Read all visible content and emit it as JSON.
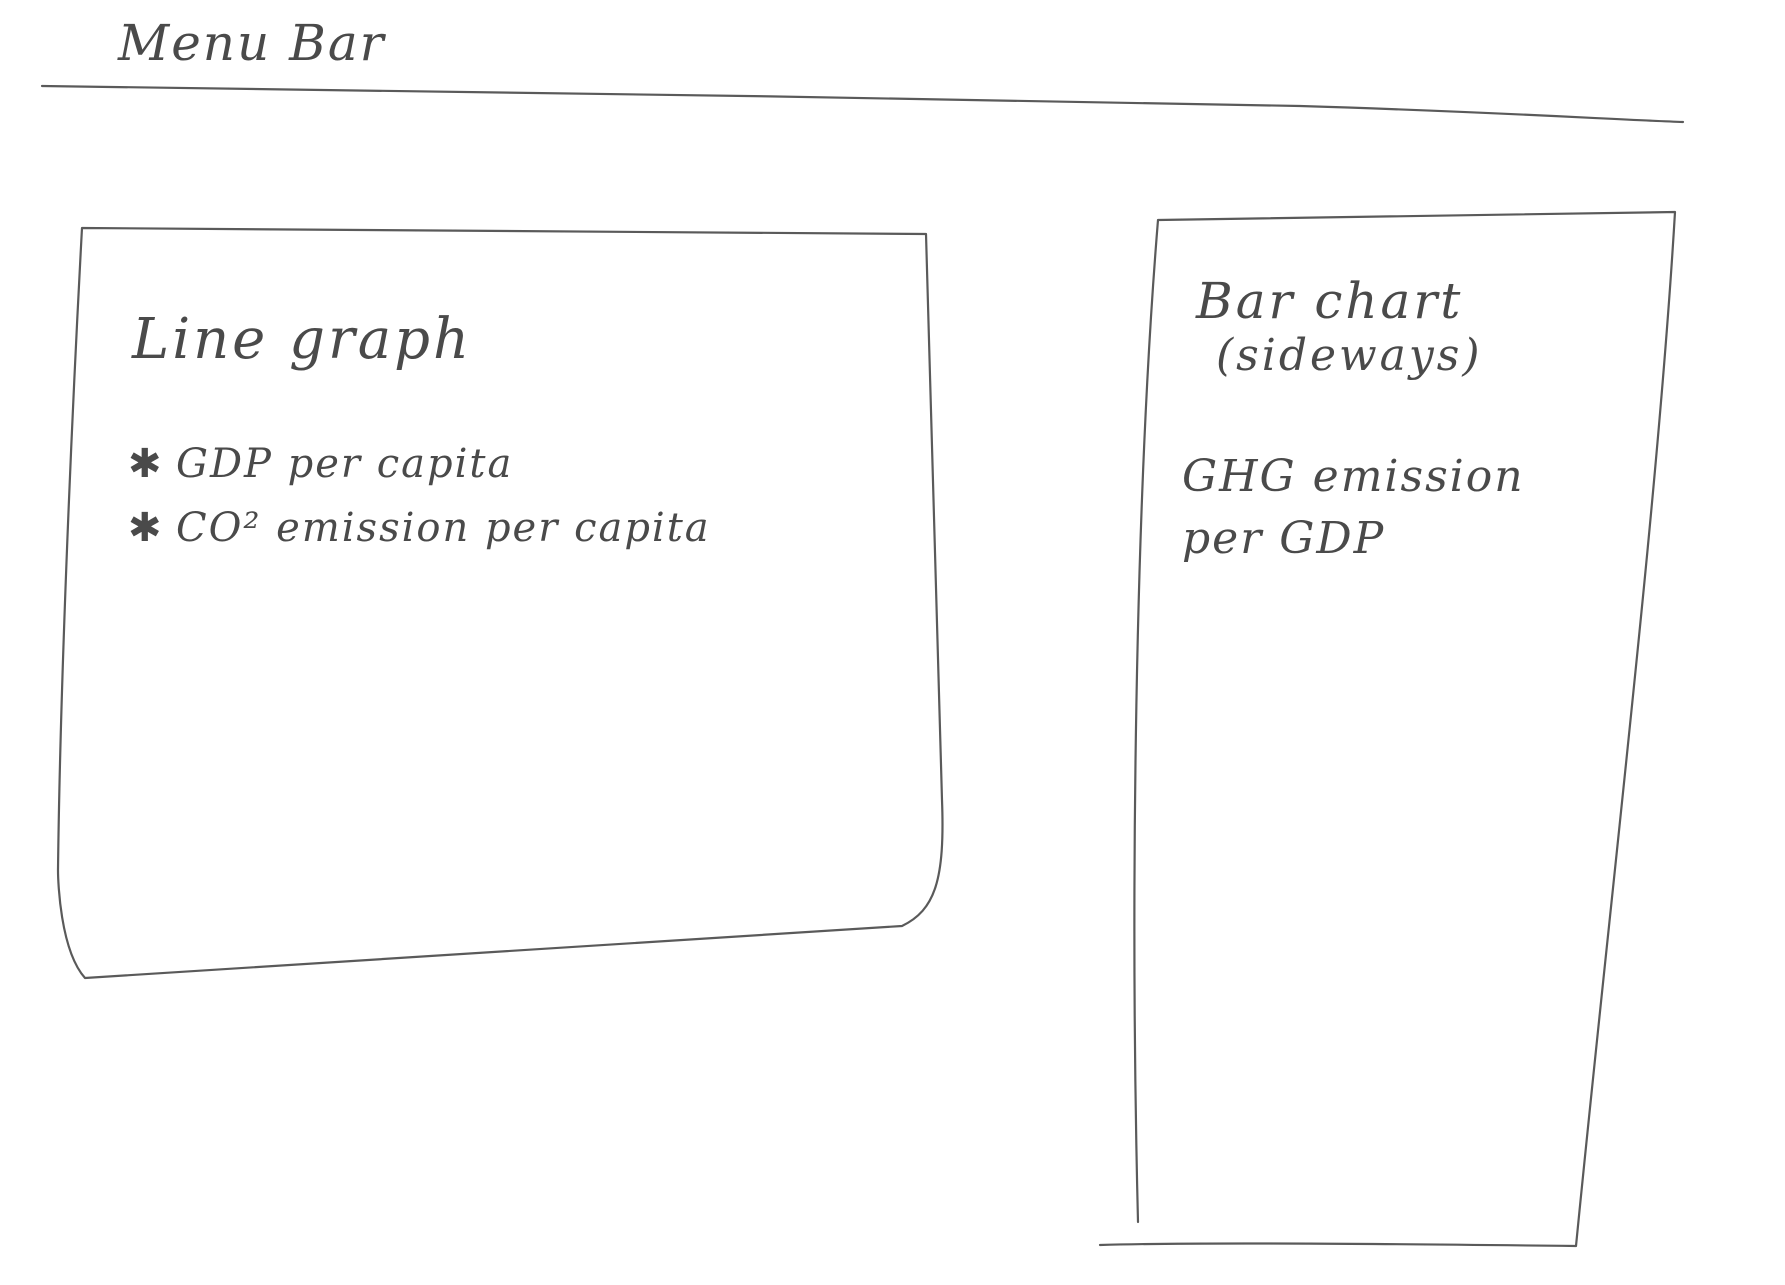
{
  "menu_bar": {
    "label": "Menu Bar"
  },
  "line_graph_panel": {
    "title": "Line graph",
    "metrics": [
      {
        "label": "GDP per capita"
      },
      {
        "label": "CO² emission per capita"
      }
    ]
  },
  "bar_chart_panel": {
    "title": "Bar chart",
    "subtitle": "(sideways)",
    "metric": "GHG emission\nper GDP"
  }
}
